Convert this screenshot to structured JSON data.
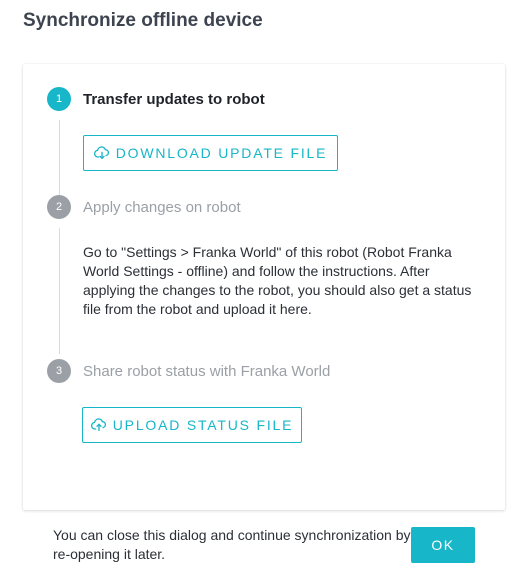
{
  "dialog": {
    "title": "Synchronize offline device"
  },
  "steps": [
    {
      "number": "1",
      "label": "Transfer updates to robot",
      "state": "active",
      "button_label": "DOWNLOAD UPDATE FILE",
      "button_icon": "cloud-download-icon"
    },
    {
      "number": "2",
      "label": "Apply changes on robot",
      "state": "inactive",
      "instructions": "Go to \"Settings > Franka World\" of this robot (Robot Franka World Settings - offline) and follow the instructions. After applying the changes to the robot, you should also get a status file from the robot and upload it here."
    },
    {
      "number": "3",
      "label": "Share robot status with Franka World",
      "state": "inactive",
      "button_label": "UPLOAD STATUS FILE",
      "button_icon": "cloud-upload-icon"
    }
  ],
  "footer": {
    "message": "You can close this dialog and continue synchronization by re-opening it later.",
    "ok_label": "OK"
  },
  "colors": {
    "accent": "#17b6c9",
    "inactive": "#9aa0a6"
  }
}
